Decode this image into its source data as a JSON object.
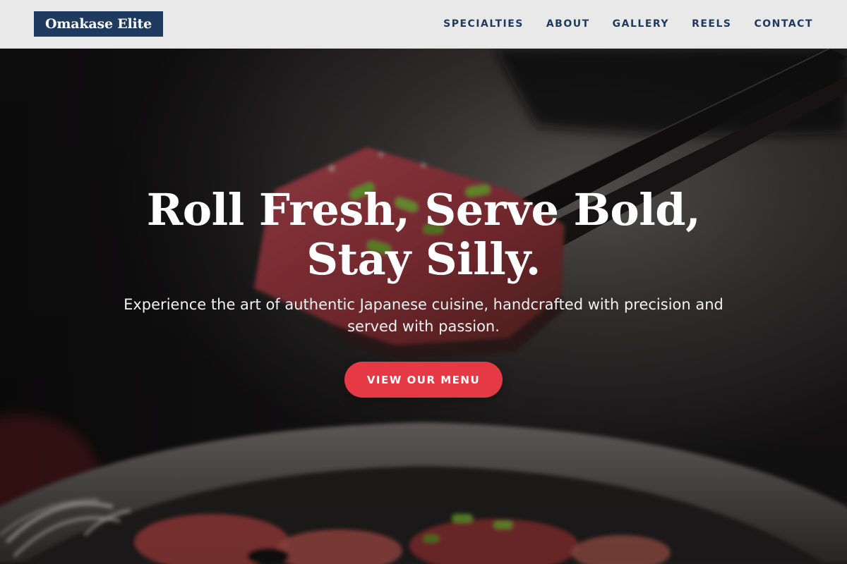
{
  "brand": {
    "name": "Omakase Elite",
    "primary_color": "#1f3a5f",
    "accent_color": "#e63946"
  },
  "nav": {
    "links": [
      "SPECIALTIES",
      "ABOUT",
      "GALLERY",
      "REELS",
      "CONTACT"
    ]
  },
  "hero": {
    "title_line1": "Roll Fresh, Serve Bold,",
    "title_line2": "Stay Silly.",
    "subtitle": "Experience the art of authentic Japanese cuisine, handcrafted with precision and served with passion.",
    "cta_label": "VIEW OUR MENU"
  }
}
